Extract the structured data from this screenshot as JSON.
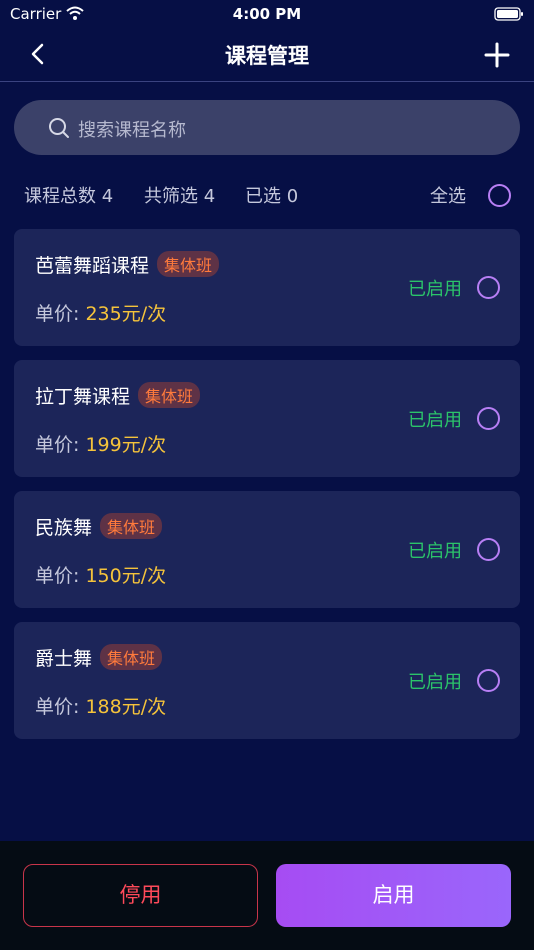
{
  "status_bar": {
    "carrier": "Carrier",
    "time": "4:00 PM"
  },
  "nav": {
    "title": "课程管理"
  },
  "search": {
    "placeholder": "搜索课程名称"
  },
  "summary": {
    "total_label": "课程总数 4",
    "filtered_label": "共筛选 4",
    "selected_label": "已选 0",
    "select_all_label": "全选"
  },
  "courses": [
    {
      "name": "芭蕾舞蹈课程",
      "tag": "集体班",
      "price_label": "单价:",
      "price": "235元/次",
      "status": "已启用"
    },
    {
      "name": "拉丁舞课程",
      "tag": "集体班",
      "price_label": "单价:",
      "price": "199元/次",
      "status": "已启用"
    },
    {
      "name": "民族舞",
      "tag": "集体班",
      "price_label": "单价:",
      "price": "150元/次",
      "status": "已启用"
    },
    {
      "name": "爵士舞",
      "tag": "集体班",
      "price_label": "单价:",
      "price": "188元/次",
      "status": "已启用"
    }
  ],
  "footer": {
    "disable_label": "停用",
    "enable_label": "启用"
  },
  "colors": {
    "background": "#060f45",
    "card": "#1c2559",
    "accent_purple": "#a64cf3",
    "enabled_green": "#2bc46a",
    "price_yellow": "#f5c33b",
    "tag_orange": "#ff7a3c",
    "danger_red": "#ff4a5a"
  },
  "icons": [
    "wifi-icon",
    "battery-icon",
    "back-arrow-icon",
    "plus-icon",
    "search-icon",
    "radio-circle-icon"
  ]
}
